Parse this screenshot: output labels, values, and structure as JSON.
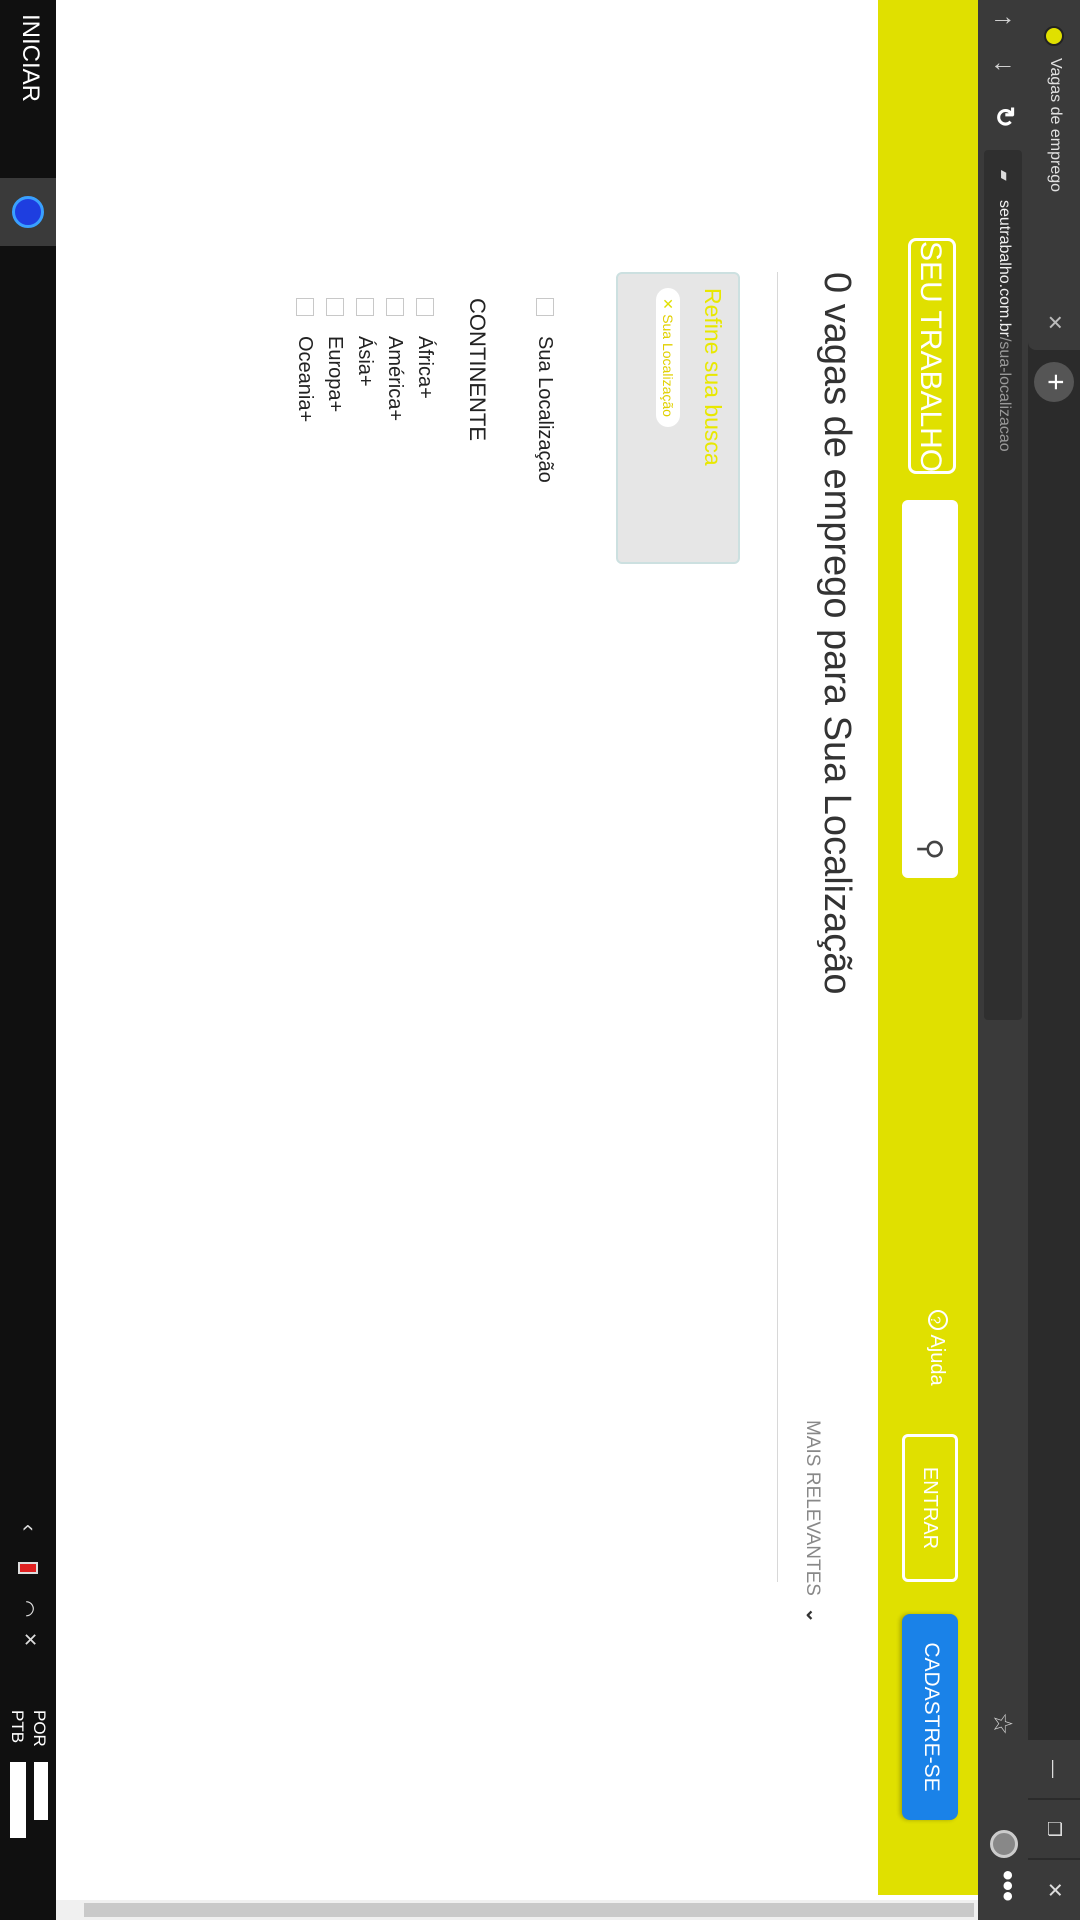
{
  "browser": {
    "tab_title": "Vagas de emprego",
    "url_domain": "seutrabalho.com.br",
    "url_path": "/sua-localizacao"
  },
  "header": {
    "logo": "SEU TRABALHO",
    "help_label": "Ajuda",
    "login_label": "ENTRAR",
    "signup_label": "CADASTRE-SE"
  },
  "main": {
    "title": "0 vagas de emprego para Sua Localização",
    "sort_label": "MAIS RELEVANTES"
  },
  "refine": {
    "title": "Refine sua busca",
    "chip_label": "Sua Localização"
  },
  "filters": {
    "location_label": "Sua Localização",
    "continent_heading": "CONTINENTE",
    "continents": [
      "África+",
      "América+",
      "Ásia+",
      "Europa+",
      "Oceania+"
    ]
  },
  "taskbar": {
    "start_label": "INICIAR",
    "lang_top": "POR",
    "lang_bottom": "PTB"
  },
  "colors": {
    "brand_yellow": "#e0e000",
    "signup_blue": "#1a82e8",
    "chip_border": "#e8e800"
  }
}
